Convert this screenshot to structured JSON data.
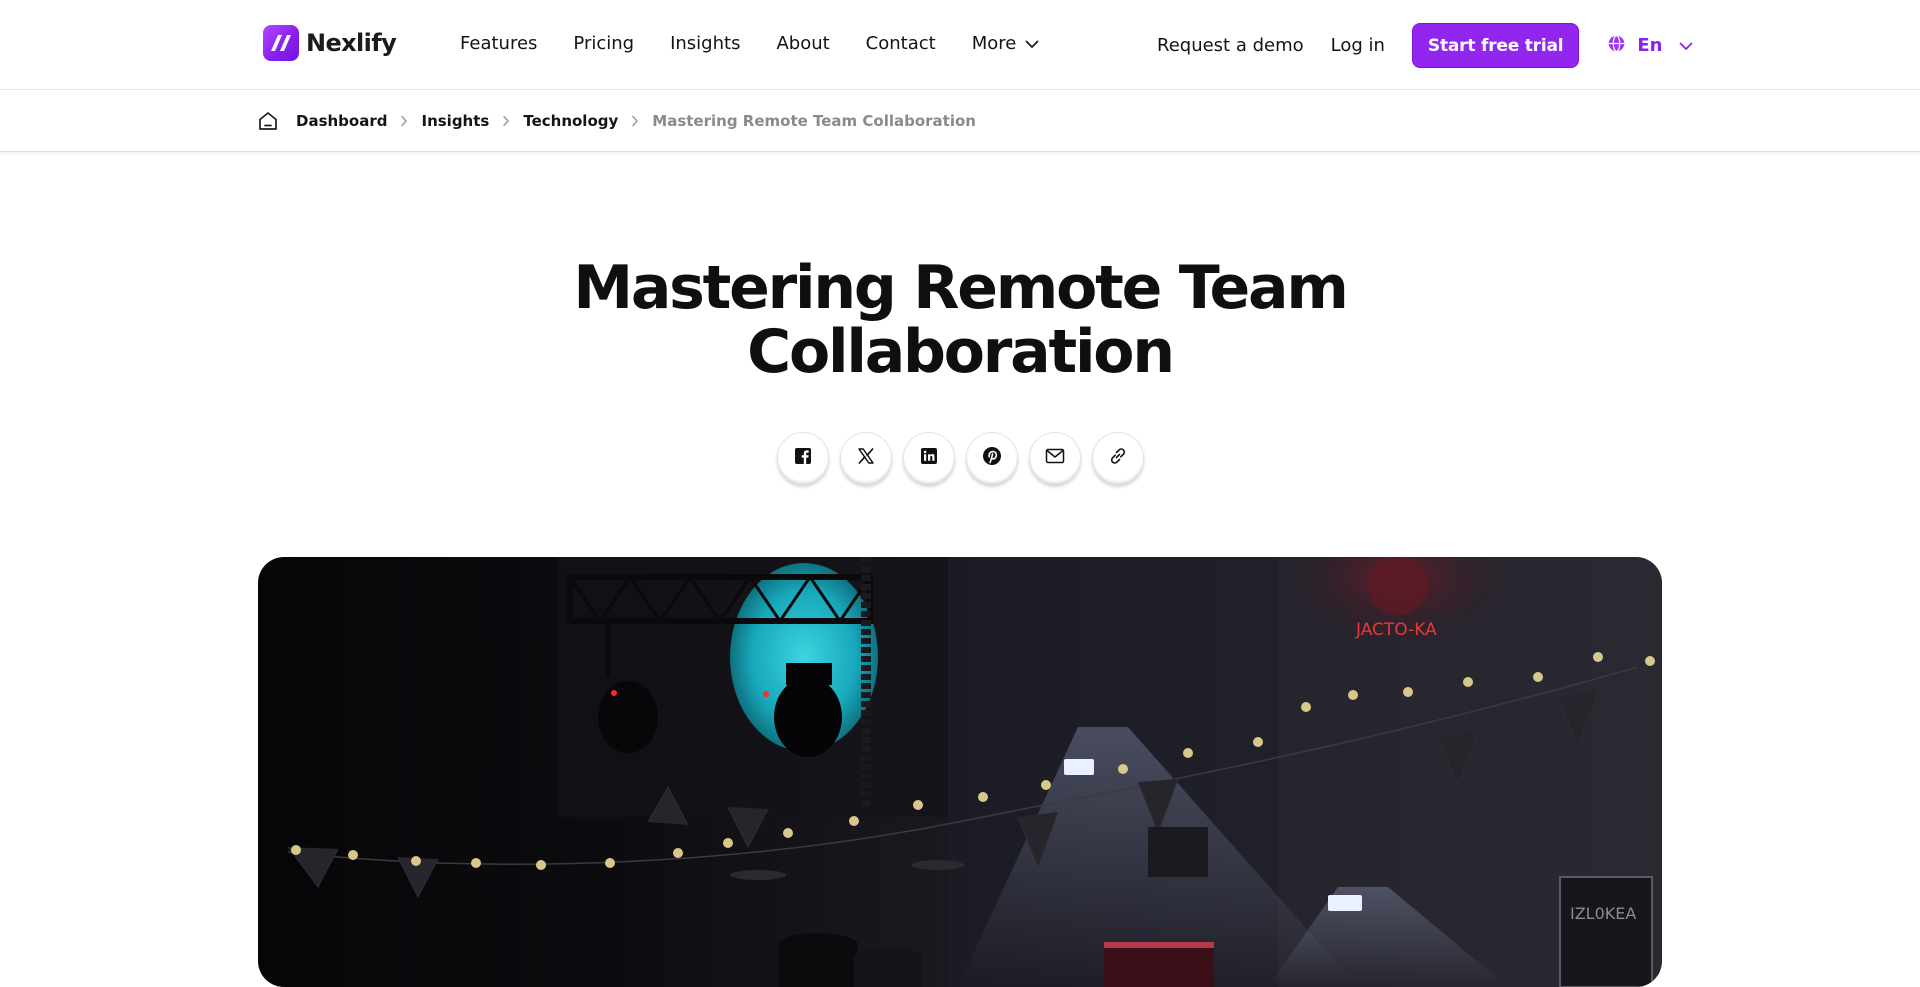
{
  "brand": {
    "name": "Nexlify",
    "logo_icon": "nexlify-logo-icon",
    "accent": "#9326ee"
  },
  "nav": {
    "items": [
      "Features",
      "Pricing",
      "Insights",
      "About",
      "Contact"
    ],
    "more_label": "More"
  },
  "actions": {
    "demo_label": "Request a demo",
    "login_label": "Log in",
    "trial_label": "Start free trial",
    "language_label": "En"
  },
  "breadcrumb": {
    "home_icon": "home-icon",
    "items": [
      "Dashboard",
      "Insights",
      "Technology"
    ],
    "current": "Mastering Remote Team Collaboration"
  },
  "article": {
    "title": "Mastering Remote Team Collaboration",
    "share_icons": [
      "facebook-icon",
      "x-icon",
      "linkedin-icon",
      "pinterest-icon",
      "email-icon",
      "link-icon"
    ],
    "hero_alt_icon": "stage-photo"
  }
}
